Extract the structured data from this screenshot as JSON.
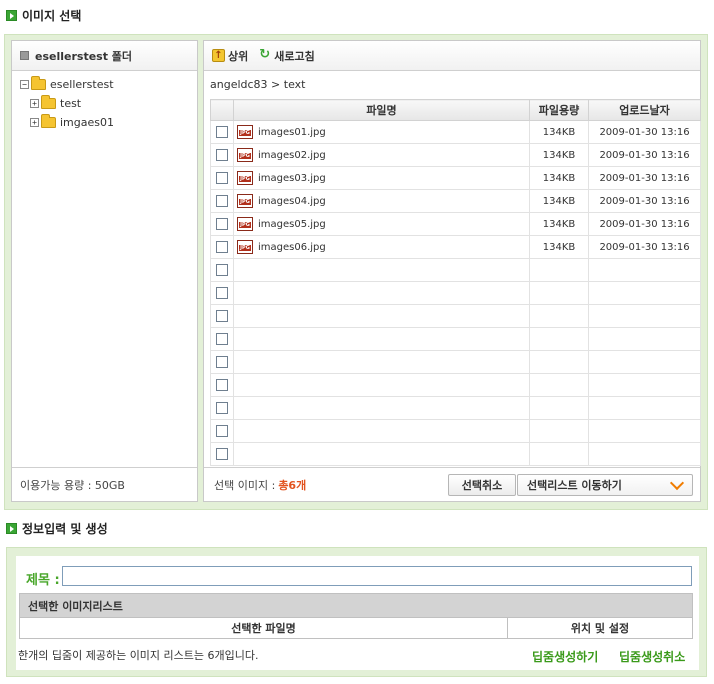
{
  "image_select": {
    "section_title": "이미지 선택",
    "folder_panel": {
      "title": "esellerstest 폴더",
      "tree": [
        {
          "label": "esellerstest",
          "expander": "−"
        },
        {
          "label": "test",
          "expander": "+"
        },
        {
          "label": "imgaes01",
          "expander": "+"
        }
      ],
      "capacity_text": "이용가능 용량 : 50GB"
    },
    "toolbar": {
      "up_label": "상위",
      "refresh_label": "새로고침"
    },
    "path": "angeldc83 > text",
    "columns": {
      "name": "파일명",
      "size": "파일용량",
      "date": "업로드날자"
    },
    "files": [
      {
        "name": "images01.jpg",
        "size": "134KB",
        "date": "2009-01-30 13:16"
      },
      {
        "name": "images02.jpg",
        "size": "134KB",
        "date": "2009-01-30 13:16"
      },
      {
        "name": "images03.jpg",
        "size": "134KB",
        "date": "2009-01-30 13:16"
      },
      {
        "name": "images04.jpg",
        "size": "134KB",
        "date": "2009-01-30 13:16"
      },
      {
        "name": "images05.jpg",
        "size": "134KB",
        "date": "2009-01-30 13:16"
      },
      {
        "name": "images06.jpg",
        "size": "134KB",
        "date": "2009-01-30 13:16"
      }
    ],
    "empty_rows": 9,
    "footer": {
      "selected_label": "선택 이미지 :",
      "selected_count": "총6개",
      "cancel_label": "선택취소",
      "move_label": "선택리스트 이동하기"
    }
  },
  "info_input": {
    "section_title": "정보입력 및 생성",
    "title_label": "제목 :",
    "title_value": "",
    "selected_list_header": "선택한 이미지리스트",
    "col_filename": "선택한 파일명",
    "col_position": "위치 및 설정",
    "note": "한개의 딥줌이 제공하는 이미지 리스트는 6개입니다.",
    "create_label": "딥줌생성하기",
    "cancel_label": "딥줌생성취소"
  },
  "colors": {
    "accent_green": "#3aa534",
    "frame_green": "#e3f0d7",
    "count_orange": "#e2531f",
    "chevron_orange": "#f07c00"
  }
}
